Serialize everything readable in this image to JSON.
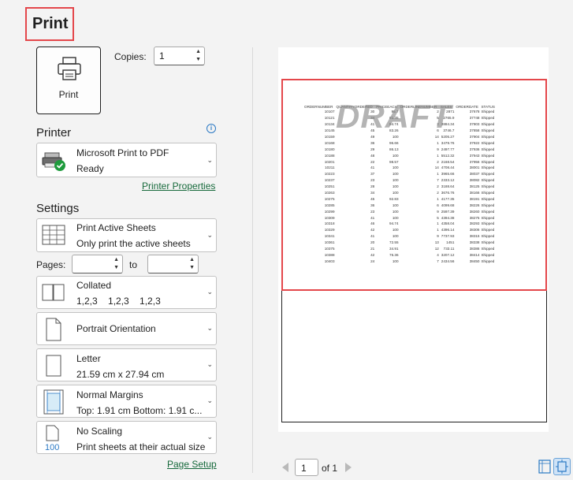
{
  "title": "Print",
  "print_button": {
    "label": "Print"
  },
  "copies": {
    "label": "Copies:",
    "value": "1"
  },
  "printer": {
    "heading": "Printer",
    "name": "Microsoft Print to PDF",
    "status": "Ready",
    "properties_link": "Printer Properties"
  },
  "settings": {
    "heading": "Settings",
    "scope": {
      "title": "Print Active Sheets",
      "subtitle": "Only print the active sheets"
    },
    "pages": {
      "label": "Pages:",
      "from": "",
      "to_label": "to",
      "to": ""
    },
    "collation": {
      "title": "Collated",
      "subtitle": "1,2,3    1,2,3    1,2,3"
    },
    "orientation": {
      "title": "Portrait Orientation"
    },
    "paper": {
      "title": "Letter",
      "subtitle": "21.59 cm x 27.94 cm"
    },
    "margins": {
      "title": "Normal Margins",
      "subtitle": "Top: 1.91 cm Bottom: 1.91 c..."
    },
    "scaling": {
      "title": "No Scaling",
      "subtitle": "Print sheets at their actual size",
      "icon_text": "100"
    },
    "page_setup_link": "Page Setup"
  },
  "preview": {
    "watermark": "DRAFT",
    "headers": [
      "ORDERNUMBER",
      "QUANTITYORDERED",
      "PRICEEACH",
      "ORDERLINENUMBER",
      "SALES",
      "ORDERDATE",
      "STATUS"
    ],
    "rows": [
      [
        "10107",
        "30",
        "95.7",
        "2",
        "2871",
        "37678",
        "Shipped"
      ],
      [
        "10121",
        "34",
        "81.35",
        "5",
        "2765.9",
        "37748",
        "Shipped"
      ],
      [
        "10134",
        "41",
        "94.74",
        "2",
        "3884.34",
        "37803",
        "Shipped"
      ],
      [
        "10145",
        "45",
        "83.26",
        "6",
        "3746.7",
        "37858",
        "Shipped"
      ],
      [
        "10159",
        "49",
        "100",
        "14",
        "5205.27",
        "37904",
        "Shipped"
      ],
      [
        "10168",
        "36",
        "96.66",
        "1",
        "3479.76",
        "37922",
        "Shipped"
      ],
      [
        "10180",
        "29",
        "86.13",
        "9",
        "2497.77",
        "37936",
        "Shipped"
      ],
      [
        "10188",
        "48",
        "100",
        "1",
        "5512.32",
        "37943",
        "Shipped"
      ],
      [
        "10201",
        "22",
        "98.57",
        "2",
        "2168.54",
        "37956",
        "Shipped"
      ],
      [
        "10211",
        "41",
        "100",
        "14",
        "4708.44",
        "38001",
        "Shipped"
      ],
      [
        "10223",
        "37",
        "100",
        "1",
        "3965.66",
        "38037",
        "Shipped"
      ],
      [
        "10237",
        "23",
        "100",
        "7",
        "2333.12",
        "38082",
        "Shipped"
      ],
      [
        "10251",
        "28",
        "100",
        "2",
        "3188.64",
        "38125",
        "Shipped"
      ],
      [
        "10263",
        "34",
        "100",
        "2",
        "3676.76",
        "38166",
        "Shipped"
      ],
      [
        "10275",
        "45",
        "92.83",
        "1",
        "4177.35",
        "38191",
        "Shipped"
      ],
      [
        "10285",
        "36",
        "100",
        "6",
        "4099.68",
        "38226",
        "Shipped"
      ],
      [
        "10299",
        "23",
        "100",
        "9",
        "2597.39",
        "38260",
        "Shipped"
      ],
      [
        "10309",
        "41",
        "100",
        "5",
        "4394.38",
        "38275",
        "Shipped"
      ],
      [
        "10318",
        "46",
        "94.74",
        "1",
        "4358.04",
        "38293",
        "Shipped"
      ],
      [
        "10329",
        "42",
        "100",
        "1",
        "4396.14",
        "38306",
        "Shipped"
      ],
      [
        "10341",
        "41",
        "100",
        "9",
        "7737.93",
        "38315",
        "Shipped"
      ],
      [
        "10361",
        "20",
        "72.55",
        "13",
        "1451",
        "38338",
        "Shipped"
      ],
      [
        "10375",
        "21",
        "34.91",
        "12",
        "733.11",
        "38386",
        "Shipped"
      ],
      [
        "10388",
        "42",
        "76.36",
        "4",
        "3207.12",
        "38414",
        "Shipped"
      ],
      [
        "10403",
        "24",
        "100",
        "7",
        "2434.56",
        "38450",
        "Shipped"
      ]
    ]
  },
  "navigation": {
    "current_page": "1",
    "of_label": "of 1"
  },
  "colors": {
    "highlight": "#e4474b",
    "link": "#16693b",
    "accent": "#2b79c4"
  }
}
